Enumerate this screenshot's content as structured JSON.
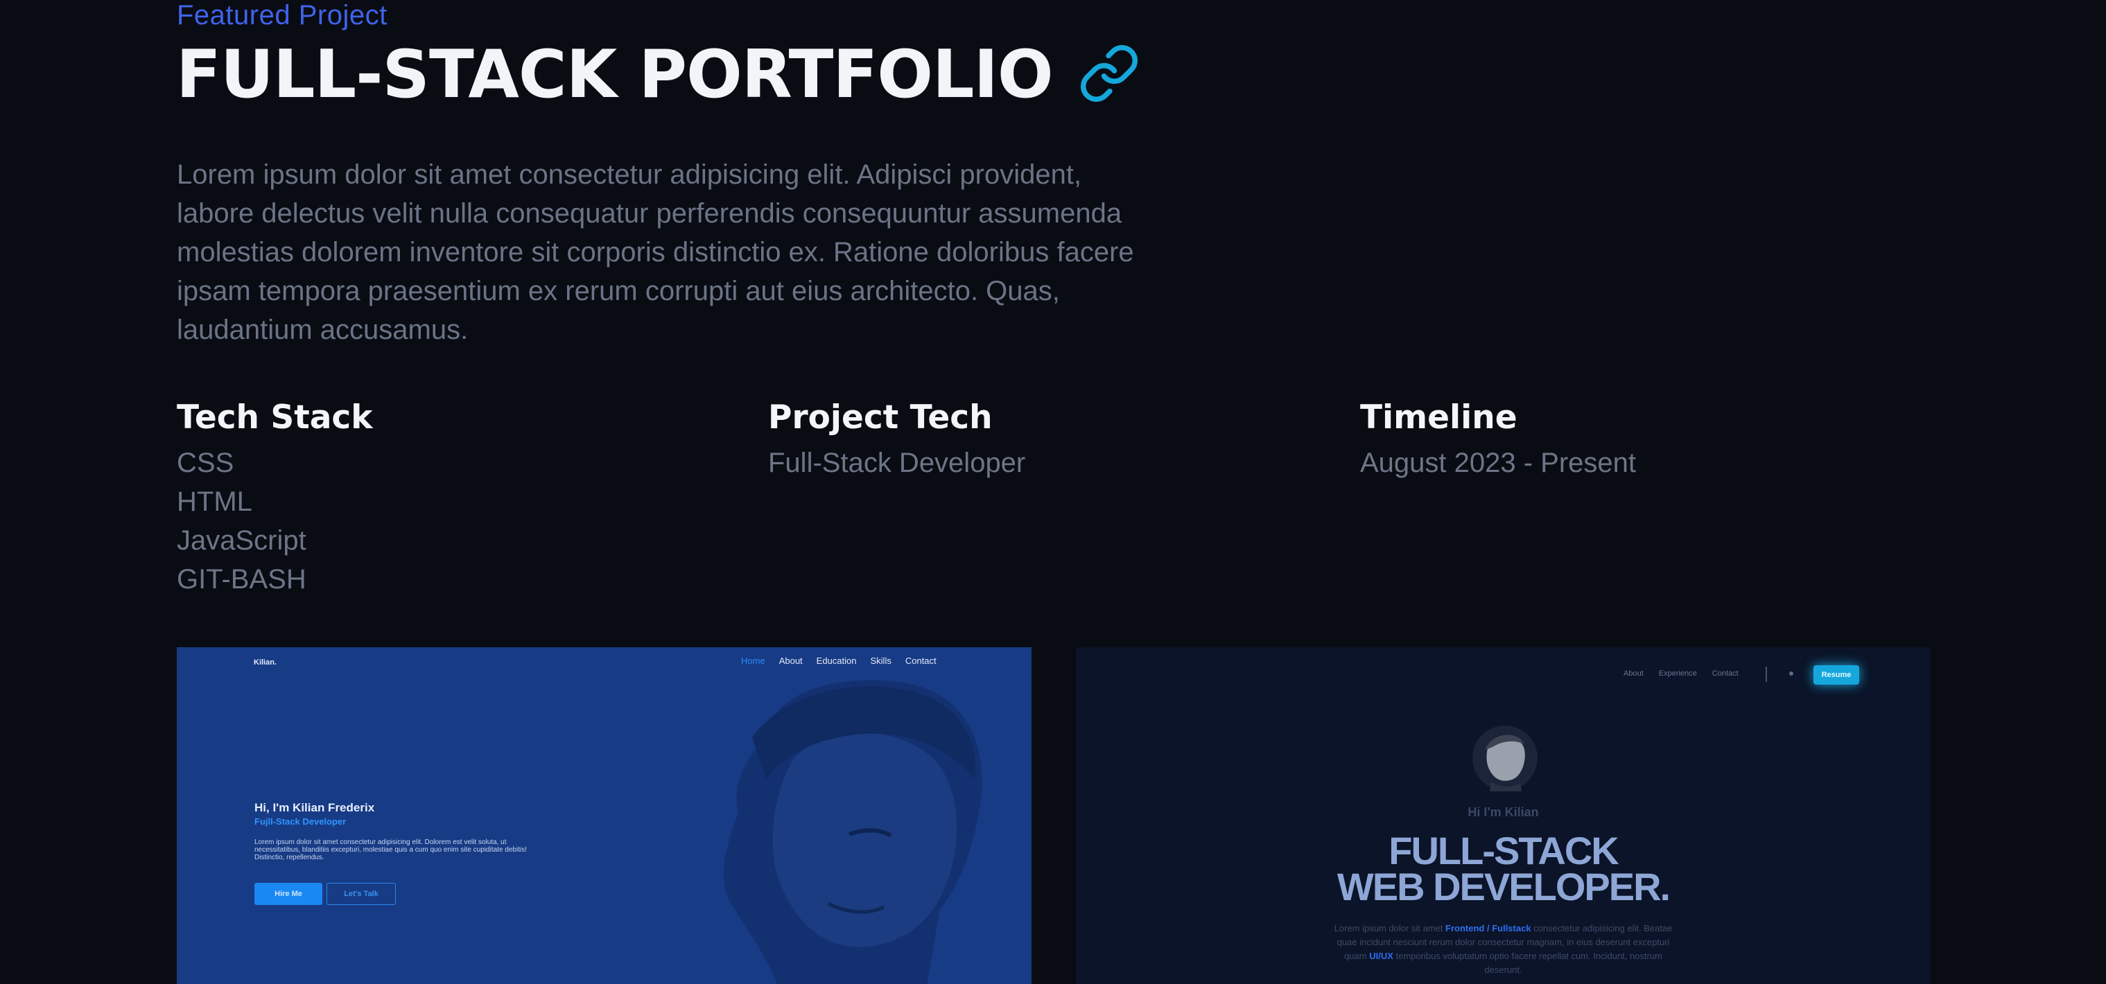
{
  "header": {
    "eyebrow": "Featured Project",
    "title": "FULL-STACK PORTFOLIO",
    "link_icon": "link-icon"
  },
  "description": "Lorem ipsum dolor sit amet consectetur adipisicing elit. Adipisci provident, labore delectus velit nulla consequatur perferendis consequuntur assumenda molestias dolorem inventore sit corporis distinctio ex. Ratione doloribus facere ipsam tempora praesentium ex rerum corrupti aut eius architecto. Quas, laudantium accusamus.",
  "sections": {
    "tech_stack": {
      "heading": "Tech Stack",
      "items": [
        "CSS",
        "HTML",
        "JavaScript",
        "GIT-BASH"
      ]
    },
    "project_tech": {
      "heading": "Project Tech",
      "items": [
        "Full-Stack Developer"
      ]
    },
    "timeline": {
      "heading": "Timeline",
      "items": [
        "August 2023 - Present"
      ]
    }
  },
  "screenshot1": {
    "brand": "Kilian.",
    "nav": [
      "Home",
      "About",
      "Education",
      "Skills",
      "Contact"
    ],
    "greeting": "Hi, I'm Kilian Frederix",
    "role": "Fujll-Stack Developer",
    "text": "Lorem ipsum dolor sit amet consectetur adipisicing elit. Dolorem est velit soluta, ut necessitatibus, blanditiis excepturi, molestiae quis a cum quo enim site cupiditate debitis! Distinctio, repellendus.",
    "hire_label": "Hire Me",
    "talk_label": "Let's Talk"
  },
  "screenshot2": {
    "nav": [
      "About",
      "Experience",
      "Contact"
    ],
    "resume_label": "Resume",
    "greeting": "Hi I'm Kilian",
    "title_line1": "FULL-STACK",
    "title_line2": "WEB DEVELOPER.",
    "text_a": "Lorem ipsum dolor sit amet ",
    "text_hl1": "Frontend / Fullstack",
    "text_b": " consectetur adipisicing elit. Beatae quae incidunt nesciunt rerum dolor consectetur magnam, in eius deserunt excepturi quam ",
    "text_hl2": "UI/UX",
    "text_c": " temporibus voluptatum optio facere repellat cum. Incidunt, nostrum deserunt."
  },
  "colors": {
    "background": "#090c13",
    "accent_blue": "#3f63ea",
    "link_icon": "#15a7db"
  }
}
